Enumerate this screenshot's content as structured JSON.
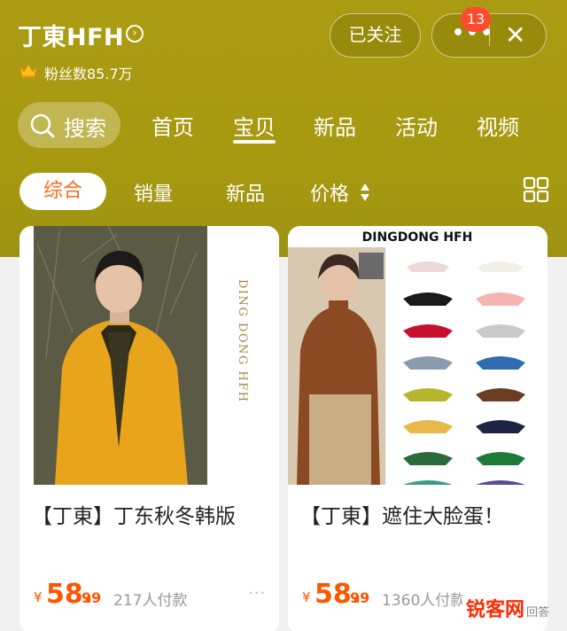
{
  "shop": {
    "name": "丁東HFH",
    "name_arrow": "›",
    "fans_label": "粉丝数85.7万"
  },
  "actions": {
    "follow_label": "已关注",
    "more_label": "•••",
    "close_label": "✕",
    "badge_count": "13"
  },
  "nav": {
    "search_label": "搜索",
    "tabs": [
      "首页",
      "宝贝",
      "新品",
      "活动",
      "视频"
    ],
    "active_tab": "宝贝"
  },
  "sort": {
    "options": [
      "综合",
      "销量",
      "新品",
      "价格"
    ],
    "active": "综合"
  },
  "products": [
    {
      "title": "【丁東】丁东秋冬韩版",
      "image_text": "DING DONG HFH",
      "price_symbol": "¥",
      "price_int": "58.",
      "price_dec": "99",
      "paid": "217人付款"
    },
    {
      "title": "【丁東】遮住大脸蛋！",
      "image_text": "DINGDONG HFH",
      "price_symbol": "¥",
      "price_int": "58.",
      "price_dec": "99",
      "paid": "1360人付款"
    }
  ],
  "watermark": {
    "text": "锐客网",
    "small": "回答"
  },
  "colors": {
    "header": "#a99a11",
    "accent": "#ff5500",
    "badge": "#ff4a2c"
  }
}
